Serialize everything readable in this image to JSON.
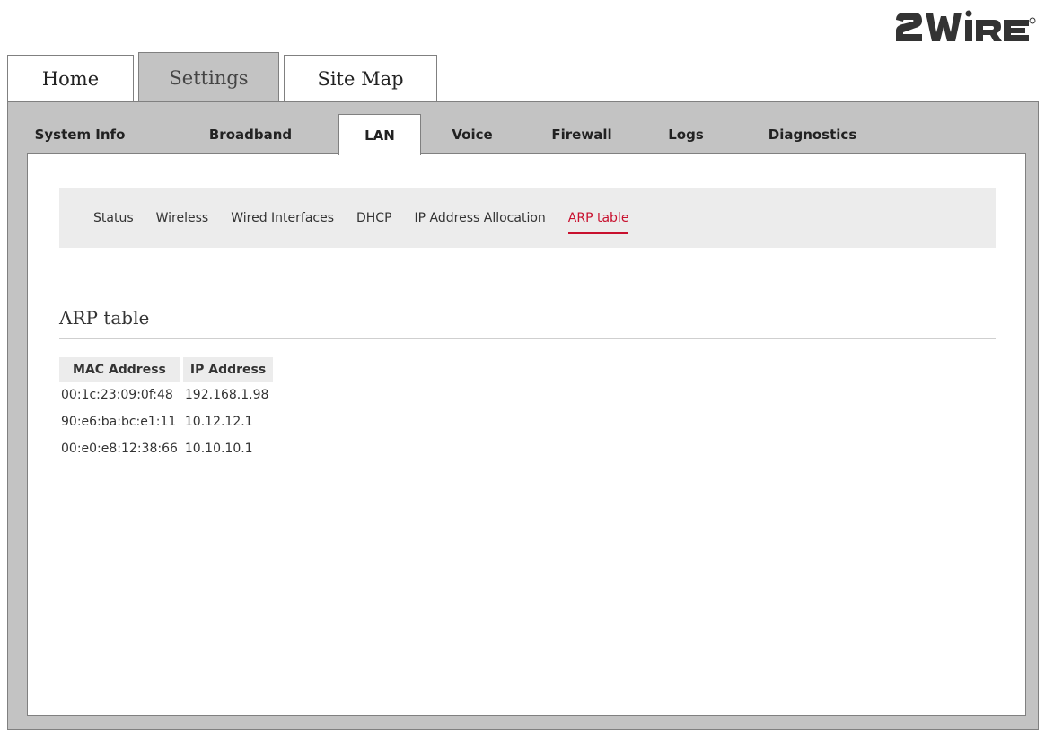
{
  "brand": {
    "logo_text": "2WIRE",
    "logo_color": "#333333"
  },
  "top_tabs": [
    {
      "label": "Home",
      "active": false
    },
    {
      "label": "Settings",
      "active": true
    },
    {
      "label": "Site Map",
      "active": false
    }
  ],
  "section_tabs": [
    {
      "label": "System Info",
      "active": false
    },
    {
      "label": "Broadband",
      "active": false
    },
    {
      "label": "LAN",
      "active": true
    },
    {
      "label": "Voice",
      "active": false
    },
    {
      "label": "Firewall",
      "active": false
    },
    {
      "label": "Logs",
      "active": false
    },
    {
      "label": "Diagnostics",
      "active": false
    }
  ],
  "subnav": [
    {
      "label": "Status",
      "active": false
    },
    {
      "label": "Wireless",
      "active": false
    },
    {
      "label": "Wired Interfaces",
      "active": false
    },
    {
      "label": "DHCP",
      "active": false
    },
    {
      "label": "IP Address Allocation",
      "active": false
    },
    {
      "label": "ARP table",
      "active": true
    }
  ],
  "page_title": "ARP table",
  "arp_table": {
    "headers": [
      "MAC Address",
      "IP Address"
    ],
    "rows": [
      [
        "00:1c:23:09:0f:48",
        "192.168.1.98"
      ],
      [
        "90:e6:ba:bc:e1:11",
        "10.12.12.1"
      ],
      [
        "00:e0:e8:12:38:66",
        "10.10.10.1"
      ]
    ]
  },
  "colors": {
    "accent": "#c8102e",
    "panel": "#c3c3c3",
    "subnav_bg": "#ececec"
  }
}
